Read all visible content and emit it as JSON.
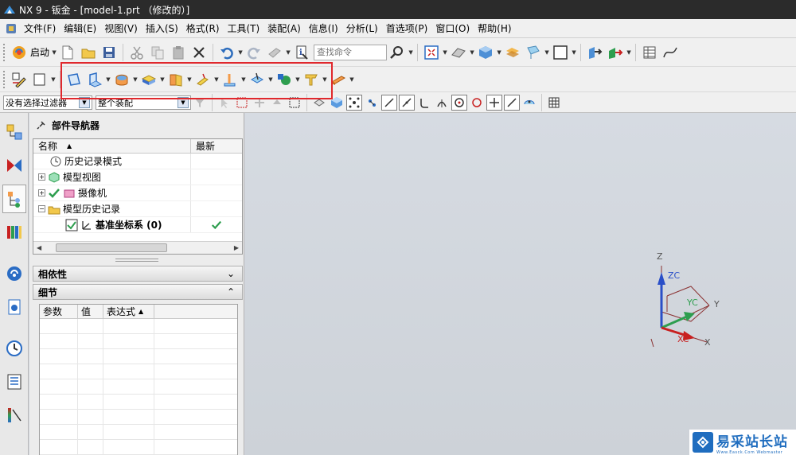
{
  "window": {
    "title": "NX 9 - 钣金 - [model-1.prt （修改的）]"
  },
  "menu": {
    "items": [
      "文件(F)",
      "编辑(E)",
      "视图(V)",
      "插入(S)",
      "格式(R)",
      "工具(T)",
      "装配(A)",
      "信息(I)",
      "分析(L)",
      "首选项(P)",
      "窗口(O)",
      "帮助(H)"
    ]
  },
  "toolbar": {
    "start_label": "启动",
    "search_placeholder": "查找命令"
  },
  "selection_bar": {
    "filter_value": "没有选择过滤器",
    "scope_value": "整个装配"
  },
  "part_navigator": {
    "title": "部件导航器",
    "columns": {
      "name": "名称",
      "latest": "最新"
    },
    "rows": [
      {
        "label": "历史记录模式",
        "bold": false
      },
      {
        "label": "模型视图",
        "bold": false
      },
      {
        "label": "摄像机",
        "bold": false
      },
      {
        "label": "模型历史记录",
        "bold": false
      },
      {
        "label": "基准坐标系 (0)",
        "bold": true
      }
    ]
  },
  "sections": {
    "dependencies": "相依性",
    "details": "细节"
  },
  "details_table": {
    "columns": [
      "参数",
      "值",
      "表达式"
    ]
  },
  "triad": {
    "z": "Z",
    "zc": "ZC",
    "yc": "YC",
    "y": "Y",
    "xc": "XC",
    "x": "X"
  },
  "watermark": {
    "text": "易采站长站",
    "sub": "Www.Easck.Com Webmaster"
  },
  "colors": {
    "highlight_box": "#e0282d",
    "titlebar": "#2b2b2b",
    "viewport": "#d2d7de"
  }
}
